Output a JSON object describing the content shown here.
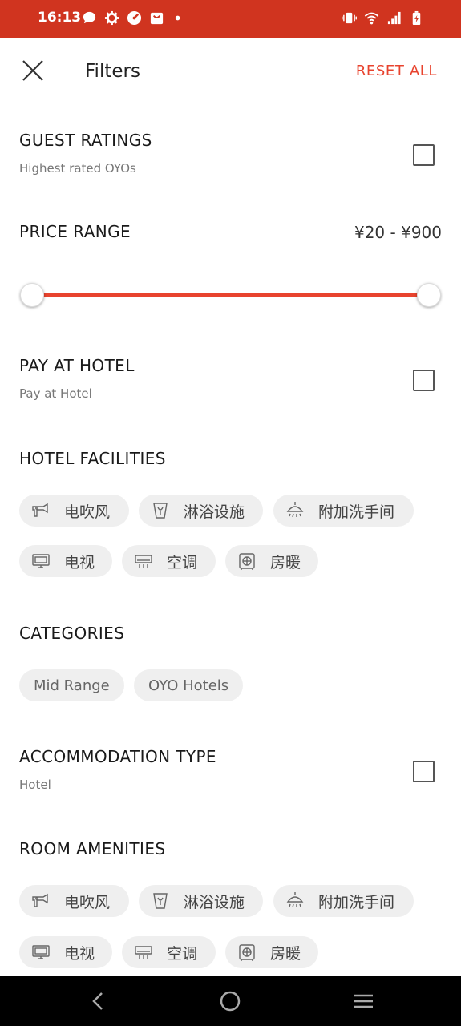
{
  "status_bar": {
    "time": "16:13"
  },
  "header": {
    "title": "Filters",
    "reset_label": "RESET ALL"
  },
  "guest_ratings": {
    "title": "GUEST RATINGS",
    "subtitle": "Highest rated OYOs",
    "checked": false
  },
  "price_range": {
    "title": "PRICE RANGE",
    "value_text": "¥20 - ¥900",
    "min_fraction": 0.0,
    "max_fraction": 1.0
  },
  "pay_at_hotel": {
    "title": "PAY AT HOTEL",
    "subtitle": "Pay at Hotel",
    "checked": false
  },
  "hotel_facilities": {
    "title": "HOTEL FACILITIES",
    "chips": [
      {
        "label": "电吹风",
        "icon": "hair-dryer-icon"
      },
      {
        "label": "淋浴设施",
        "icon": "shower-facility-icon"
      },
      {
        "label": "附加洗手间",
        "icon": "shower-head-icon"
      },
      {
        "label": "电视",
        "icon": "tv-icon"
      },
      {
        "label": "空调",
        "icon": "air-conditioner-icon"
      },
      {
        "label": "房暖",
        "icon": "heater-icon"
      }
    ]
  },
  "categories": {
    "title": "CATEGORIES",
    "chips": [
      {
        "label": "Mid Range"
      },
      {
        "label": "OYO Hotels"
      }
    ]
  },
  "accommodation_type": {
    "title": "ACCOMMODATION TYPE",
    "subtitle": "Hotel",
    "checked": false
  },
  "room_amenities": {
    "title": "ROOM AMENITIES",
    "chips": [
      {
        "label": "电吹风",
        "icon": "hair-dryer-icon"
      },
      {
        "label": "淋浴设施",
        "icon": "shower-facility-icon"
      },
      {
        "label": "附加洗手间",
        "icon": "shower-head-icon"
      },
      {
        "label": "电视",
        "icon": "tv-icon"
      },
      {
        "label": "空调",
        "icon": "air-conditioner-icon"
      },
      {
        "label": "房暖",
        "icon": "heater-icon"
      }
    ]
  },
  "colors": {
    "status_bar": "#d0341f",
    "accent": "#e8432e",
    "chip_bg": "#efefef"
  }
}
